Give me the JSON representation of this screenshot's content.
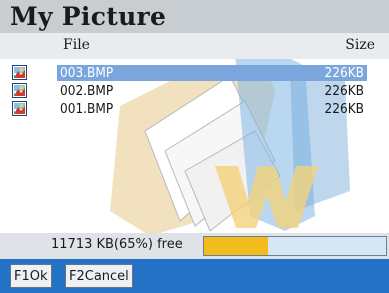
{
  "header": {
    "title": "My Picture"
  },
  "columns": {
    "file": "File",
    "size": "Size"
  },
  "files": [
    {
      "name": "003.BMP",
      "size": "226KB",
      "icon": "bitmap-file-icon",
      "selected": true
    },
    {
      "name": "002.BMP",
      "size": "226KB",
      "icon": "bitmap-file-icon",
      "selected": false
    },
    {
      "name": "001.BMP",
      "size": "226KB",
      "icon": "bitmap-file-icon",
      "selected": false
    }
  ],
  "status": {
    "free_text": "11713 KB(65%) free",
    "used_fraction": 0.35
  },
  "softkeys": {
    "ok_label": "F1Ok",
    "cancel_label": "F2Cancel"
  },
  "colors": {
    "title_bar": "#c8cdd2",
    "selection": "#7aa6dd",
    "progress_fill": "#f2bd1c",
    "softkey_bar": "#2372c6"
  }
}
